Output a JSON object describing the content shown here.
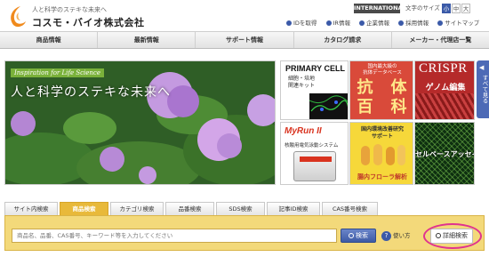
{
  "header": {
    "tagline": "人と科学のステキな未来へ",
    "company": "コスモ・バイオ株式会社",
    "international": "INTERNATIONAL",
    "font_size_label": "文字のサイズ",
    "font_sizes": [
      "小",
      "中",
      "大"
    ],
    "links": [
      "IDを取得",
      "IR情報",
      "企業情報",
      "採用情報",
      "サイトマップ"
    ],
    "brand_color": "#f08a1c"
  },
  "nav": {
    "items": [
      "商品情報",
      "最新情報",
      "サポート情報",
      "カタログ請求",
      "メーカー・代理店一覧"
    ]
  },
  "hero": {
    "subtitle": "Inspiration for Life Science",
    "title": "人と科学のステキな未来へ"
  },
  "banners": {
    "primary_cell": {
      "title": "PRIMARY CELL",
      "line1": "細胞・培地",
      "line2": "関連キット"
    },
    "antibody": {
      "line1": "国内最大級の",
      "line2": "抗体データベース",
      "big1": "抗　体",
      "big2": "百　科"
    },
    "crispr": {
      "title": "CRISPR",
      "sub": "ゲノム編集"
    },
    "myrun": {
      "logo": "MyRun II",
      "caption": "核酸用電気泳動システム"
    },
    "flora": {
      "line1": "国内環境改善研究",
      "line2": "サポート",
      "caption": "腸内フローラ解析"
    },
    "cellbase": {
      "title": "セルベースアッセイ"
    },
    "side_tab": "すべて見る"
  },
  "search": {
    "tabs": [
      "サイト内検索",
      "商品検索",
      "カテゴリ検索",
      "品番検索",
      "SDS検索",
      "記事ID検索",
      "CAS番号検索"
    ],
    "active_tab": "商品検索",
    "placeholder": "商品名、品番、CAS番号、キーワード等を入力してください",
    "button": "検索",
    "help": "使い方",
    "detail": "詳細検索"
  }
}
